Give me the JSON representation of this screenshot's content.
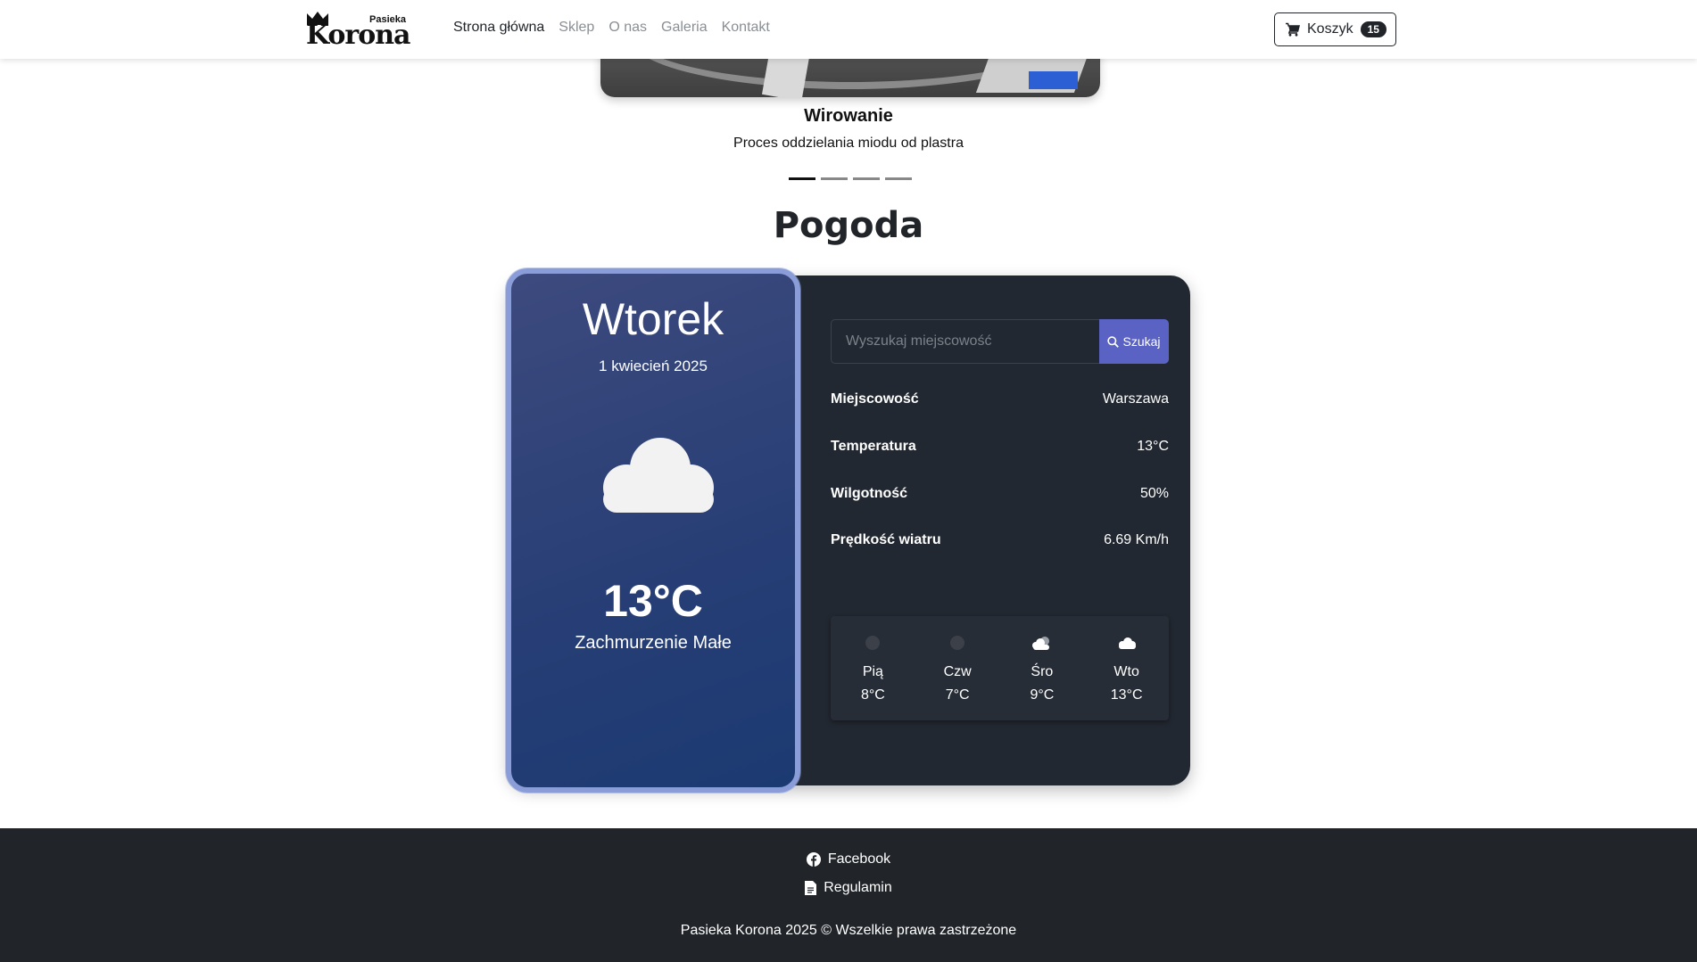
{
  "navbar": {
    "brand_small": "Pasieka",
    "brand_big": "Korona",
    "links": [
      "Strona główna",
      "Sklep",
      "O nas",
      "Galeria",
      "Kontakt"
    ],
    "active_link": "Strona główna",
    "cart_label": "Koszyk",
    "cart_count": "15"
  },
  "carousel": {
    "title": "Wirowanie",
    "subtitle": "Proces oddzielania miodu od plastra",
    "slide_count": 4,
    "active_index": 0
  },
  "weather": {
    "section_title": "Pogoda",
    "day_name": "Wtorek",
    "date": "1 kwiecień 2025",
    "icon": "cloud-icon",
    "temperature": "13°C",
    "description": "Zachmurzenie Małe",
    "search": {
      "placeholder": "Wyszukaj miejscowość",
      "value": "",
      "button_label": "Szukaj"
    },
    "details": [
      {
        "key": "Miejscowość",
        "value": "Warszawa"
      },
      {
        "key": "Temperatura",
        "value": "13°C"
      },
      {
        "key": "Wilgotność",
        "value": "50%"
      },
      {
        "key": "Prędkość wiatru",
        "value": "6.69 Km/h"
      }
    ],
    "forecast": [
      {
        "day": "Pią",
        "temp": "8°C",
        "icon": "dot-icon"
      },
      {
        "day": "Czw",
        "temp": "7°C",
        "icon": "dot-icon"
      },
      {
        "day": "Śro",
        "temp": "9°C",
        "icon": "sun-cloud-icon"
      },
      {
        "day": "Wto",
        "temp": "13°C",
        "icon": "cloud-icon"
      }
    ]
  },
  "footer": {
    "facebook_label": "Facebook",
    "terms_label": "Regulamin",
    "copyright": "Pasieka Korona 2025 © Wszelkie prawa zastrzeżone"
  },
  "colors": {
    "accent": "#5a63c3",
    "card_dark": "#222831",
    "left_panel": "#263e75",
    "footer_bg": "#212529"
  }
}
